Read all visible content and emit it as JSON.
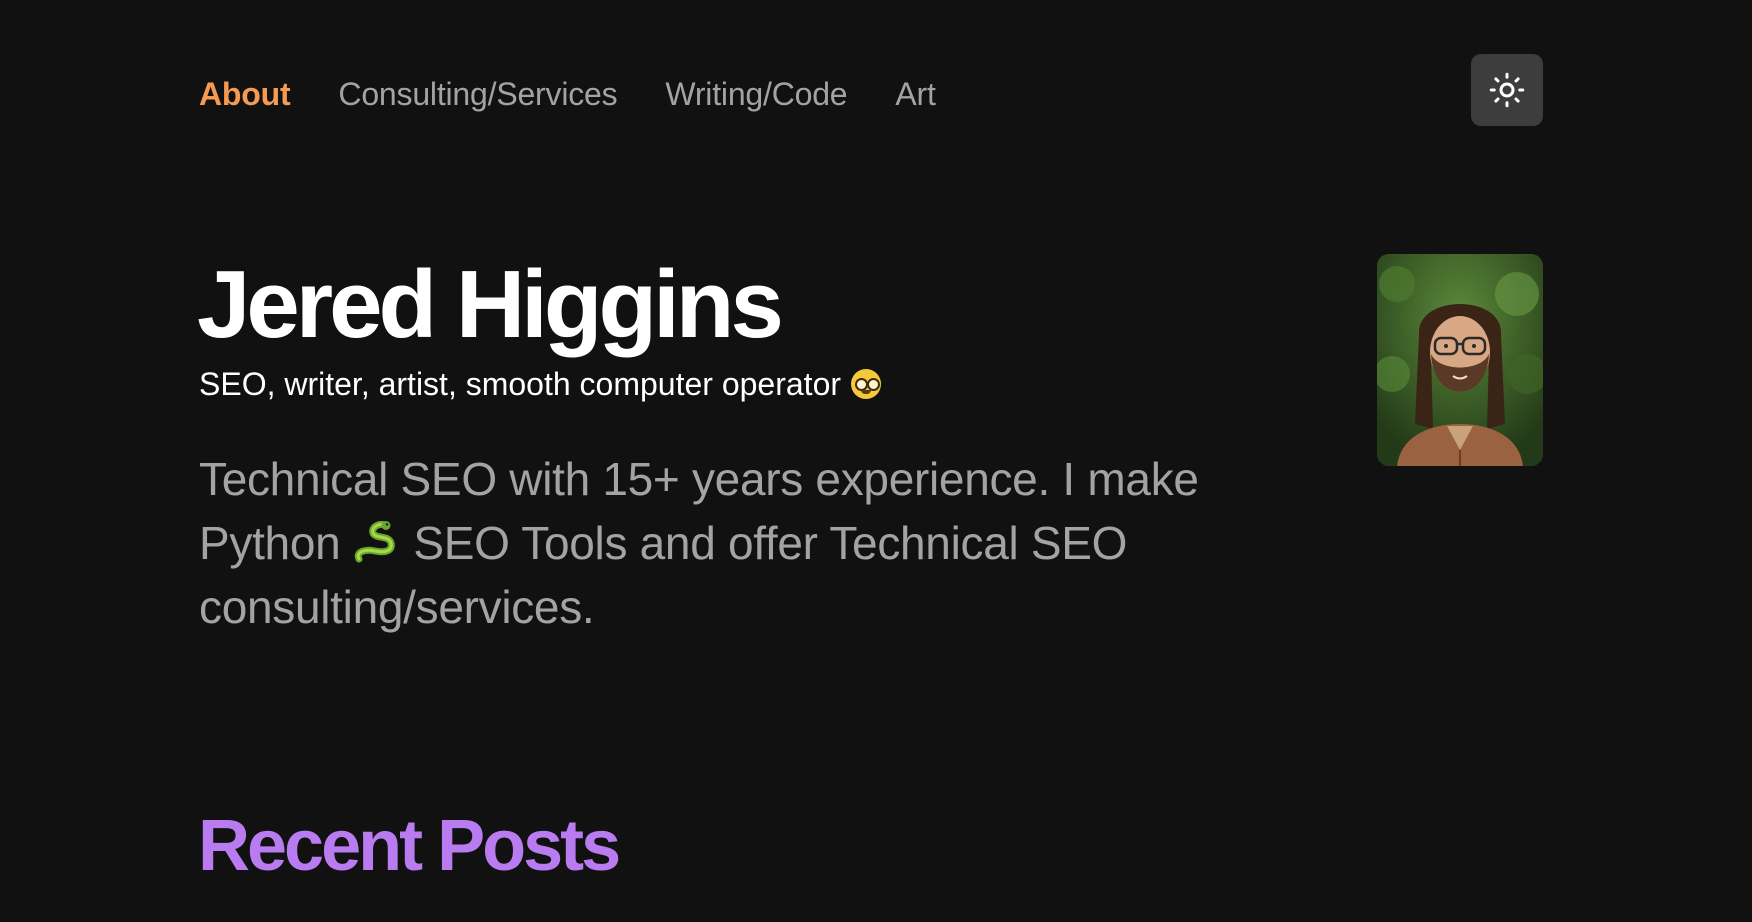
{
  "nav": {
    "items": [
      {
        "label": "About",
        "active": true
      },
      {
        "label": "Consulting/Services",
        "active": false
      },
      {
        "label": "Writing/Code",
        "active": false
      },
      {
        "label": "Art",
        "active": false
      }
    ],
    "theme_toggle_icon": "sun-icon"
  },
  "hero": {
    "name": "Jered Higgins",
    "tagline": "SEO, writer, artist, smooth computer operator",
    "tagline_emoji": "nerd-face-icon",
    "intro_part1": "Technical SEO with 15+ years experience. I make Python",
    "intro_emoji": "snake-icon",
    "intro_part2": "SEO Tools and offer Technical SEO consulting/services."
  },
  "avatar": {
    "icon": "profile-photo"
  },
  "recent_posts": {
    "title": "Recent Posts"
  },
  "colors": {
    "background": "#111111",
    "active_nav": "#f59a52",
    "nav_text": "#a3a3a3",
    "heading": "#ffffff",
    "section_heading": "#b97cf0",
    "toggle_bg": "#3d3d3d"
  }
}
